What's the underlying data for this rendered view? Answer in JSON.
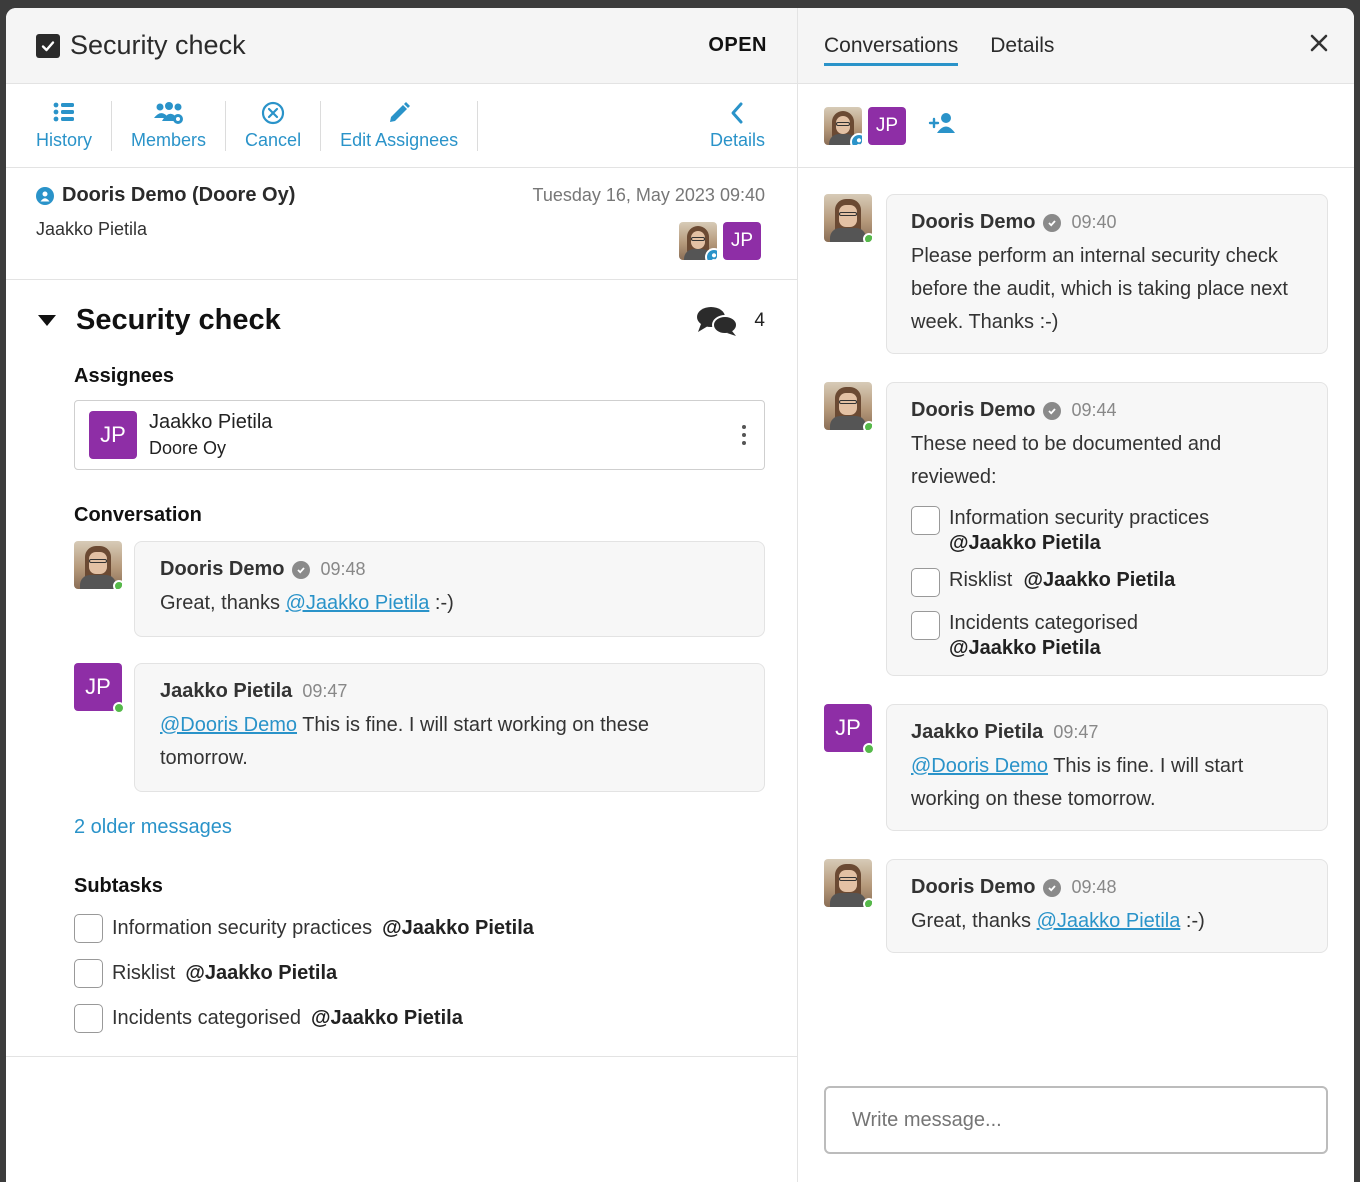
{
  "left": {
    "title": "Security check",
    "status": "OPEN",
    "toolbar": {
      "history": "History",
      "members": "Members",
      "cancel": "Cancel",
      "edit_assignees": "Edit Assignees",
      "details": "Details"
    },
    "meta": {
      "creator": "Dooris Demo (Doore Oy)",
      "date": "Tuesday 16, May 2023 09:40",
      "assignee": "Jaakko Pietila",
      "jp_initials": "JP"
    },
    "task": {
      "title": "Security check",
      "comment_count": "4",
      "assignees_label": "Assignees",
      "assignee_initials": "JP",
      "assignee_name": "Jaakko Pietila",
      "assignee_org": "Doore Oy",
      "conversation_label": "Conversation",
      "messages": [
        {
          "name": "Dooris Demo",
          "time": "09:48",
          "before": "Great, thanks ",
          "mention": "@Jaakko Pietila",
          "after": " :-)"
        },
        {
          "name": "Jaakko Pietila",
          "initials": "JP",
          "time": "09:47",
          "mention": "@Dooris Demo",
          "after": " This is fine. I will start working on these tomorrow."
        }
      ],
      "older_messages": "2 older messages",
      "subtasks_label": "Subtasks",
      "subtasks": [
        {
          "label": "Information security practices",
          "mention": "@Jaakko Pietila"
        },
        {
          "label": "Risklist",
          "mention": "@Jaakko Pietila"
        },
        {
          "label": "Incidents categorised",
          "mention": "@Jaakko Pietila"
        }
      ]
    }
  },
  "right": {
    "tabs": [
      "Conversations",
      "Details"
    ],
    "members_initials": "JP",
    "messages": [
      {
        "name": "Dooris Demo",
        "time": "09:40",
        "text": "Please perform an internal security check before the audit, which is taking place next week. Thanks :-)"
      },
      {
        "name": "Dooris Demo",
        "time": "09:44",
        "text": "These need to be documented and reviewed:",
        "subtasks": [
          {
            "label": "Information security practices",
            "mention": "@Jaakko Pietila"
          },
          {
            "label": "Risklist",
            "mention": "@Jaakko Pietila"
          },
          {
            "label": "Incidents categorised",
            "mention": "@Jaakko Pietila"
          }
        ]
      },
      {
        "name": "Jaakko Pietila",
        "initials": "JP",
        "time": "09:47",
        "mention": "@Dooris Demo",
        "after": " This is fine. I will start working on these tomorrow."
      },
      {
        "name": "Dooris Demo",
        "time": "09:48",
        "before": "Great, thanks ",
        "mention": "@Jaakko Pietila",
        "after": " :-)"
      }
    ],
    "compose_placeholder": "Write message..."
  },
  "colors": {
    "accent": "#2a93c9",
    "avatar_purple": "#8e2ea6",
    "online": "#55b94a"
  }
}
